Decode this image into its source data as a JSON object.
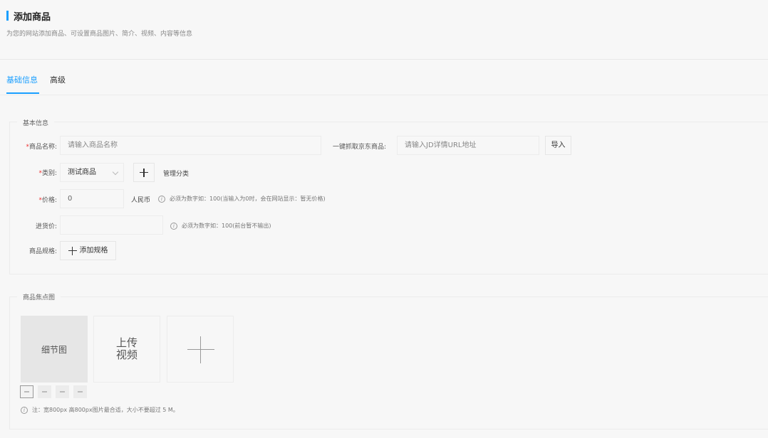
{
  "header": {
    "title": "添加商品",
    "subtitle": "为您的网站添加商品、可设置商品图片、简介、视频、内容等信息",
    "accent_color": "#1a9fff"
  },
  "tabs": [
    {
      "label": "基础信息",
      "active": true
    },
    {
      "label": "高级",
      "active": false
    }
  ],
  "basic_section": {
    "legend": "基本信息",
    "product_name": {
      "label": "商品名称:",
      "placeholder": "请输入商品名称",
      "value": ""
    },
    "jd_fetch": {
      "label": "一键抓取京东商品:",
      "placeholder": "请输入JD详情URL地址",
      "import_label": "导入"
    },
    "category": {
      "label": "类别:",
      "selected": "测试商品",
      "manage_label": "管理分类"
    },
    "price": {
      "label": "价格:",
      "value": "0",
      "unit": "人民币",
      "hint": "必须为数字如：100(当输入为0时，会在网站显示：暂无价格)"
    },
    "cost_price": {
      "label": "进货价:",
      "value": "",
      "hint": "必须为数字如：100(前台暂不输出)"
    },
    "spec": {
      "label": "商品规格:",
      "add_label": "添加规格"
    }
  },
  "image_section": {
    "legend": "商品焦点图",
    "detail_label": "细节图",
    "video_label": "上传\n视频",
    "mini_thumbs": [
      "detail",
      "empty",
      "empty",
      "empty"
    ],
    "note": "注：宽800px 高800px图片最合适，大小不要超过 5 M。"
  },
  "icons": {
    "info": "i",
    "required_marker": "*"
  }
}
